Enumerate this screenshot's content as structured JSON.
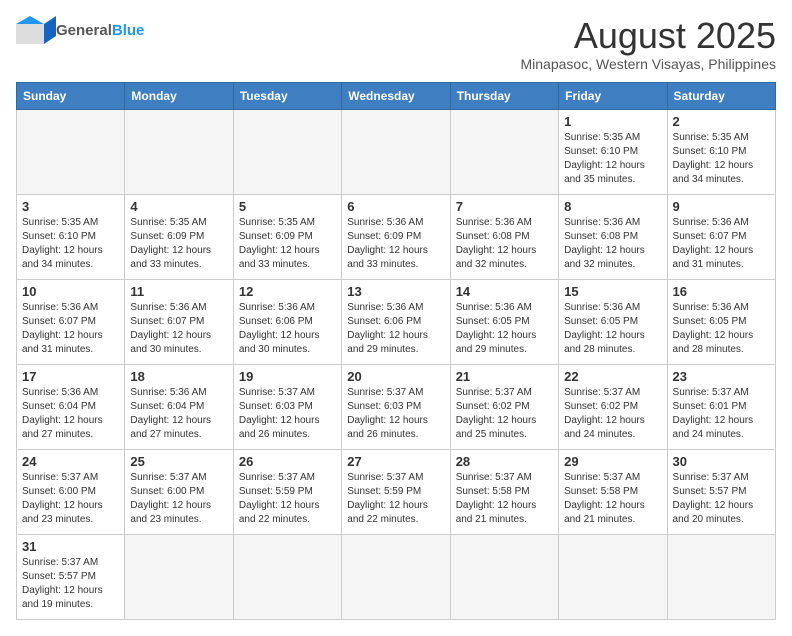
{
  "logo": {
    "text_general": "General",
    "text_blue": "Blue"
  },
  "title": "August 2025",
  "subtitle": "Minapasoc, Western Visayas, Philippines",
  "weekdays": [
    "Sunday",
    "Monday",
    "Tuesday",
    "Wednesday",
    "Thursday",
    "Friday",
    "Saturday"
  ],
  "weeks": [
    [
      {
        "day": "",
        "info": ""
      },
      {
        "day": "",
        "info": ""
      },
      {
        "day": "",
        "info": ""
      },
      {
        "day": "",
        "info": ""
      },
      {
        "day": "",
        "info": ""
      },
      {
        "day": "1",
        "info": "Sunrise: 5:35 AM\nSunset: 6:10 PM\nDaylight: 12 hours\nand 35 minutes."
      },
      {
        "day": "2",
        "info": "Sunrise: 5:35 AM\nSunset: 6:10 PM\nDaylight: 12 hours\nand 34 minutes."
      }
    ],
    [
      {
        "day": "3",
        "info": "Sunrise: 5:35 AM\nSunset: 6:10 PM\nDaylight: 12 hours\nand 34 minutes."
      },
      {
        "day": "4",
        "info": "Sunrise: 5:35 AM\nSunset: 6:09 PM\nDaylight: 12 hours\nand 33 minutes."
      },
      {
        "day": "5",
        "info": "Sunrise: 5:35 AM\nSunset: 6:09 PM\nDaylight: 12 hours\nand 33 minutes."
      },
      {
        "day": "6",
        "info": "Sunrise: 5:36 AM\nSunset: 6:09 PM\nDaylight: 12 hours\nand 33 minutes."
      },
      {
        "day": "7",
        "info": "Sunrise: 5:36 AM\nSunset: 6:08 PM\nDaylight: 12 hours\nand 32 minutes."
      },
      {
        "day": "8",
        "info": "Sunrise: 5:36 AM\nSunset: 6:08 PM\nDaylight: 12 hours\nand 32 minutes."
      },
      {
        "day": "9",
        "info": "Sunrise: 5:36 AM\nSunset: 6:07 PM\nDaylight: 12 hours\nand 31 minutes."
      }
    ],
    [
      {
        "day": "10",
        "info": "Sunrise: 5:36 AM\nSunset: 6:07 PM\nDaylight: 12 hours\nand 31 minutes."
      },
      {
        "day": "11",
        "info": "Sunrise: 5:36 AM\nSunset: 6:07 PM\nDaylight: 12 hours\nand 30 minutes."
      },
      {
        "day": "12",
        "info": "Sunrise: 5:36 AM\nSunset: 6:06 PM\nDaylight: 12 hours\nand 30 minutes."
      },
      {
        "day": "13",
        "info": "Sunrise: 5:36 AM\nSunset: 6:06 PM\nDaylight: 12 hours\nand 29 minutes."
      },
      {
        "day": "14",
        "info": "Sunrise: 5:36 AM\nSunset: 6:05 PM\nDaylight: 12 hours\nand 29 minutes."
      },
      {
        "day": "15",
        "info": "Sunrise: 5:36 AM\nSunset: 6:05 PM\nDaylight: 12 hours\nand 28 minutes."
      },
      {
        "day": "16",
        "info": "Sunrise: 5:36 AM\nSunset: 6:05 PM\nDaylight: 12 hours\nand 28 minutes."
      }
    ],
    [
      {
        "day": "17",
        "info": "Sunrise: 5:36 AM\nSunset: 6:04 PM\nDaylight: 12 hours\nand 27 minutes."
      },
      {
        "day": "18",
        "info": "Sunrise: 5:36 AM\nSunset: 6:04 PM\nDaylight: 12 hours\nand 27 minutes."
      },
      {
        "day": "19",
        "info": "Sunrise: 5:37 AM\nSunset: 6:03 PM\nDaylight: 12 hours\nand 26 minutes."
      },
      {
        "day": "20",
        "info": "Sunrise: 5:37 AM\nSunset: 6:03 PM\nDaylight: 12 hours\nand 26 minutes."
      },
      {
        "day": "21",
        "info": "Sunrise: 5:37 AM\nSunset: 6:02 PM\nDaylight: 12 hours\nand 25 minutes."
      },
      {
        "day": "22",
        "info": "Sunrise: 5:37 AM\nSunset: 6:02 PM\nDaylight: 12 hours\nand 24 minutes."
      },
      {
        "day": "23",
        "info": "Sunrise: 5:37 AM\nSunset: 6:01 PM\nDaylight: 12 hours\nand 24 minutes."
      }
    ],
    [
      {
        "day": "24",
        "info": "Sunrise: 5:37 AM\nSunset: 6:00 PM\nDaylight: 12 hours\nand 23 minutes."
      },
      {
        "day": "25",
        "info": "Sunrise: 5:37 AM\nSunset: 6:00 PM\nDaylight: 12 hours\nand 23 minutes."
      },
      {
        "day": "26",
        "info": "Sunrise: 5:37 AM\nSunset: 5:59 PM\nDaylight: 12 hours\nand 22 minutes."
      },
      {
        "day": "27",
        "info": "Sunrise: 5:37 AM\nSunset: 5:59 PM\nDaylight: 12 hours\nand 22 minutes."
      },
      {
        "day": "28",
        "info": "Sunrise: 5:37 AM\nSunset: 5:58 PM\nDaylight: 12 hours\nand 21 minutes."
      },
      {
        "day": "29",
        "info": "Sunrise: 5:37 AM\nSunset: 5:58 PM\nDaylight: 12 hours\nand 21 minutes."
      },
      {
        "day": "30",
        "info": "Sunrise: 5:37 AM\nSunset: 5:57 PM\nDaylight: 12 hours\nand 20 minutes."
      }
    ],
    [
      {
        "day": "31",
        "info": "Sunrise: 5:37 AM\nSunset: 5:57 PM\nDaylight: 12 hours\nand 19 minutes."
      },
      {
        "day": "",
        "info": ""
      },
      {
        "day": "",
        "info": ""
      },
      {
        "day": "",
        "info": ""
      },
      {
        "day": "",
        "info": ""
      },
      {
        "day": "",
        "info": ""
      },
      {
        "day": "",
        "info": ""
      }
    ]
  ]
}
